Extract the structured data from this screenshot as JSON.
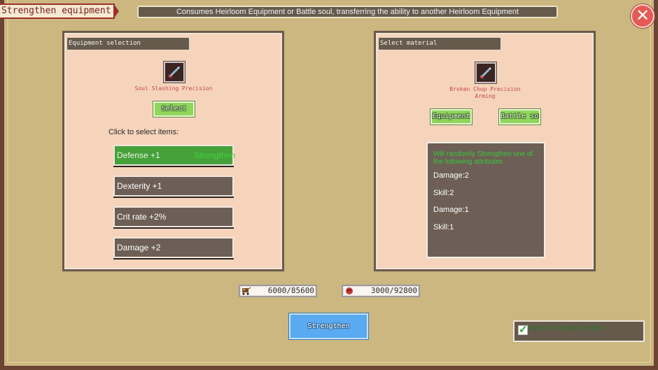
{
  "header": {
    "title": "Strengthen equipment",
    "description": "Consumes Heirloom Equipment or Battle soul, transferring the ability to another Heirloom Equipment",
    "close_label": "✕"
  },
  "equipment_panel": {
    "header": "Equipment selection",
    "item_name": "Soul Slashing Precision",
    "item_icon": "sword-icon",
    "select_label": "Select",
    "click_label": "Click to select items:",
    "attributes": [
      {
        "label": "Defense +1",
        "tag": "Strengthen",
        "selected": true
      },
      {
        "label": "Dexterity +1"
      },
      {
        "label": "Crit rate +2%"
      },
      {
        "label": "Damage +2"
      }
    ]
  },
  "material_panel": {
    "header": "Select material",
    "item_name": "Broken Chop Precision Arming",
    "item_icon": "sword-icon",
    "equipment_label": "Equipment",
    "battle_soul_label": "Battle soul",
    "info_title": "Will randomly Strengthen one of the following attributes",
    "info_lines": [
      "Damage:2",
      "Skill:2",
      "Damage:1",
      "Skill:1"
    ]
  },
  "resources": [
    {
      "icon": "cart-icon",
      "value": "6000/85600"
    },
    {
      "icon": "soul-icon",
      "value": "3000/92800"
    }
  ],
  "strengthen_label": "Strengthen",
  "reset_option": {
    "label": "Reset no longer prompts",
    "checked": true
  },
  "colors": {
    "accent_green": "#8fd65a",
    "accent_blue": "#59aaf0",
    "panel_bg": "#f6d4bc",
    "title_red": "#9e2f2a"
  }
}
